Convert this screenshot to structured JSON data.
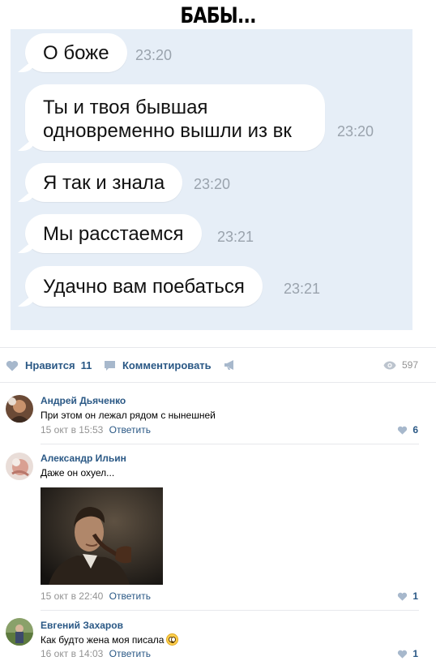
{
  "meme": {
    "title": "БАБЫ...",
    "messages": [
      {
        "text": "О боже",
        "time": "23:20"
      },
      {
        "text": "Ты и твоя бывшая одновременно вышли из вк",
        "time": "23:20"
      },
      {
        "text": "Я так и знала",
        "time": "23:20"
      },
      {
        "text": "Мы расстаемся",
        "time": "23:21"
      },
      {
        "text": "Удачно вам поебаться",
        "time": "23:21"
      }
    ]
  },
  "actions": {
    "like_label": "Нравится",
    "like_count": "11",
    "comment_label": "Комментировать",
    "views_count": "597"
  },
  "comments": [
    {
      "author": "Андрей Дьяченко",
      "text": "При этом он лежал рядом с нынешней",
      "date": "15 окт в 15:53",
      "reply": "Ответить",
      "likes": "6"
    },
    {
      "author": "Александр Ильин",
      "text": "Даже он охуел...",
      "date": "15 окт в 22:40",
      "reply": "Ответить",
      "likes": "1"
    },
    {
      "author": "Евгений Захаров",
      "text": "Как будто жена моя писала",
      "date": "16 окт в 14:03",
      "reply": "Ответить",
      "likes": "1"
    }
  ],
  "colors": {
    "link": "#2a5885",
    "chat_bg": "#e6eef7",
    "muted": "#939393"
  },
  "icons": [
    "heart-icon",
    "comment-icon",
    "share-megaphone-icon",
    "eye-icon",
    "flushed-emoji-icon"
  ]
}
